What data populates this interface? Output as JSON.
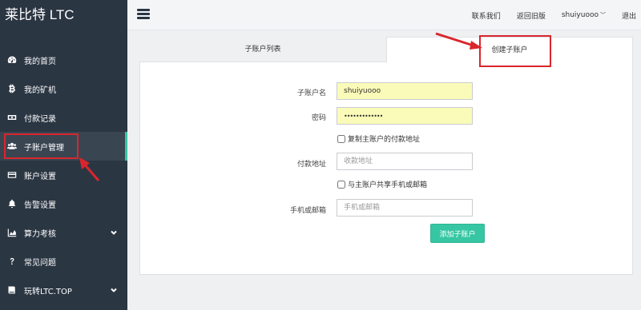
{
  "brand": "莱比特 LTC",
  "sidebar": {
    "items": [
      {
        "label": "我的首页",
        "icon": "dashboard-icon"
      },
      {
        "label": "我的矿机",
        "icon": "bitcoin-icon"
      },
      {
        "label": "付款记录",
        "icon": "money-icon"
      },
      {
        "label": "子账户管理",
        "icon": "users-icon",
        "active": true
      },
      {
        "label": "账户设置",
        "icon": "credit-card-icon"
      },
      {
        "label": "告警设置",
        "icon": "bell-icon"
      },
      {
        "label": "算力考核",
        "icon": "area-chart-icon",
        "expandable": true
      },
      {
        "label": "常见问题",
        "icon": "question-icon"
      },
      {
        "label": "玩转LTC.TOP",
        "icon": "book-icon",
        "expandable": true
      }
    ]
  },
  "header": {
    "links": [
      "联系我们",
      "返回旧版",
      "shuiyuooo",
      "退出"
    ]
  },
  "tabs": {
    "list": "子账户列表",
    "create": "创建子账户"
  },
  "form": {
    "name_label": "子账户名",
    "name_value": "shuiyuooo",
    "password_label": "密码",
    "password_value": "•••••••••••••",
    "copy_address_label": "复制主账户的付款地址",
    "address_label": "付款地址",
    "address_placeholder": "收款地址",
    "share_contact_label": "与主账户共享手机或邮箱",
    "contact_label": "手机或邮箱",
    "contact_placeholder": "手机或邮箱",
    "submit_label": "添加子账户"
  },
  "colors": {
    "sidebar_bg": "#2b3643",
    "accent": "#36c6a3",
    "highlight": "#d9262c",
    "autofill": "#fbfbb9"
  }
}
